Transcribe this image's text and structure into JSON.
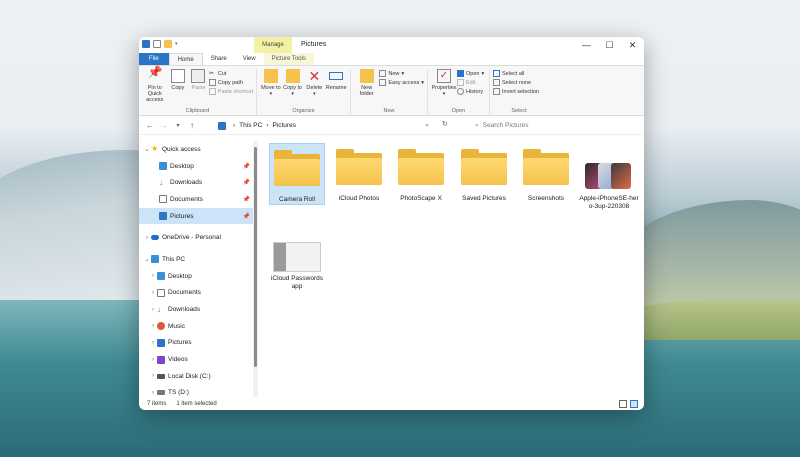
{
  "window": {
    "title": "Pictures",
    "context_tab": "Manage",
    "controls": {
      "minimize": "—",
      "maximize": "☐",
      "close": "✕"
    }
  },
  "tabs": [
    "File",
    "Home",
    "Share",
    "View",
    "Picture Tools"
  ],
  "ribbon": {
    "clipboard": {
      "label": "Clipboard",
      "pin": "Pin to Quick access",
      "copy": "Copy",
      "paste": "Paste",
      "cut": "Cut",
      "copy_path": "Copy path",
      "paste_shortcut": "Paste shortcut"
    },
    "organize": {
      "label": "Organize",
      "move_to": "Move to",
      "copy_to": "Copy to",
      "delete": "Delete",
      "rename": "Rename"
    },
    "new": {
      "label": "New",
      "new_folder": "New folder",
      "new_item": "New",
      "easy_access": "Easy access"
    },
    "open": {
      "label": "Open",
      "properties": "Properties",
      "open": "Open",
      "edit": "Edit",
      "history": "History"
    },
    "select": {
      "label": "Select",
      "select_all": "Select all",
      "select_none": "Select none",
      "invert": "Invert selection"
    }
  },
  "address": {
    "path": [
      "This PC",
      "Pictures"
    ],
    "search_placeholder": "Search Pictures"
  },
  "sidebar": {
    "quick_access": "Quick access",
    "quick_items": [
      "Desktop",
      "Downloads",
      "Documents",
      "Pictures"
    ],
    "onedrive": "OneDrive - Personal",
    "this_pc": "This PC",
    "pc_items": [
      "Desktop",
      "Documents",
      "Downloads",
      "Music",
      "Pictures",
      "Videos",
      "Local Disk (C:)",
      "TS (D:)"
    ]
  },
  "files": [
    {
      "name": "Camera Roll",
      "type": "folder"
    },
    {
      "name": "iCloud Photos",
      "type": "folder"
    },
    {
      "name": "PhotoScape X",
      "type": "folder"
    },
    {
      "name": "Saved Pictures",
      "type": "folder"
    },
    {
      "name": "Screenshots",
      "type": "folder"
    },
    {
      "name": "Apple-iPhoneSE-hero-3up-220308",
      "type": "image"
    },
    {
      "name": "iCloud Passwords app",
      "type": "image"
    }
  ],
  "status": {
    "items": "7 items",
    "selected": "1 item selected"
  },
  "colors": {
    "accent": "#2a76c6",
    "selection": "#cce4f7",
    "folder": "#f4c24d",
    "manage_tab": "#f3f1a4"
  }
}
